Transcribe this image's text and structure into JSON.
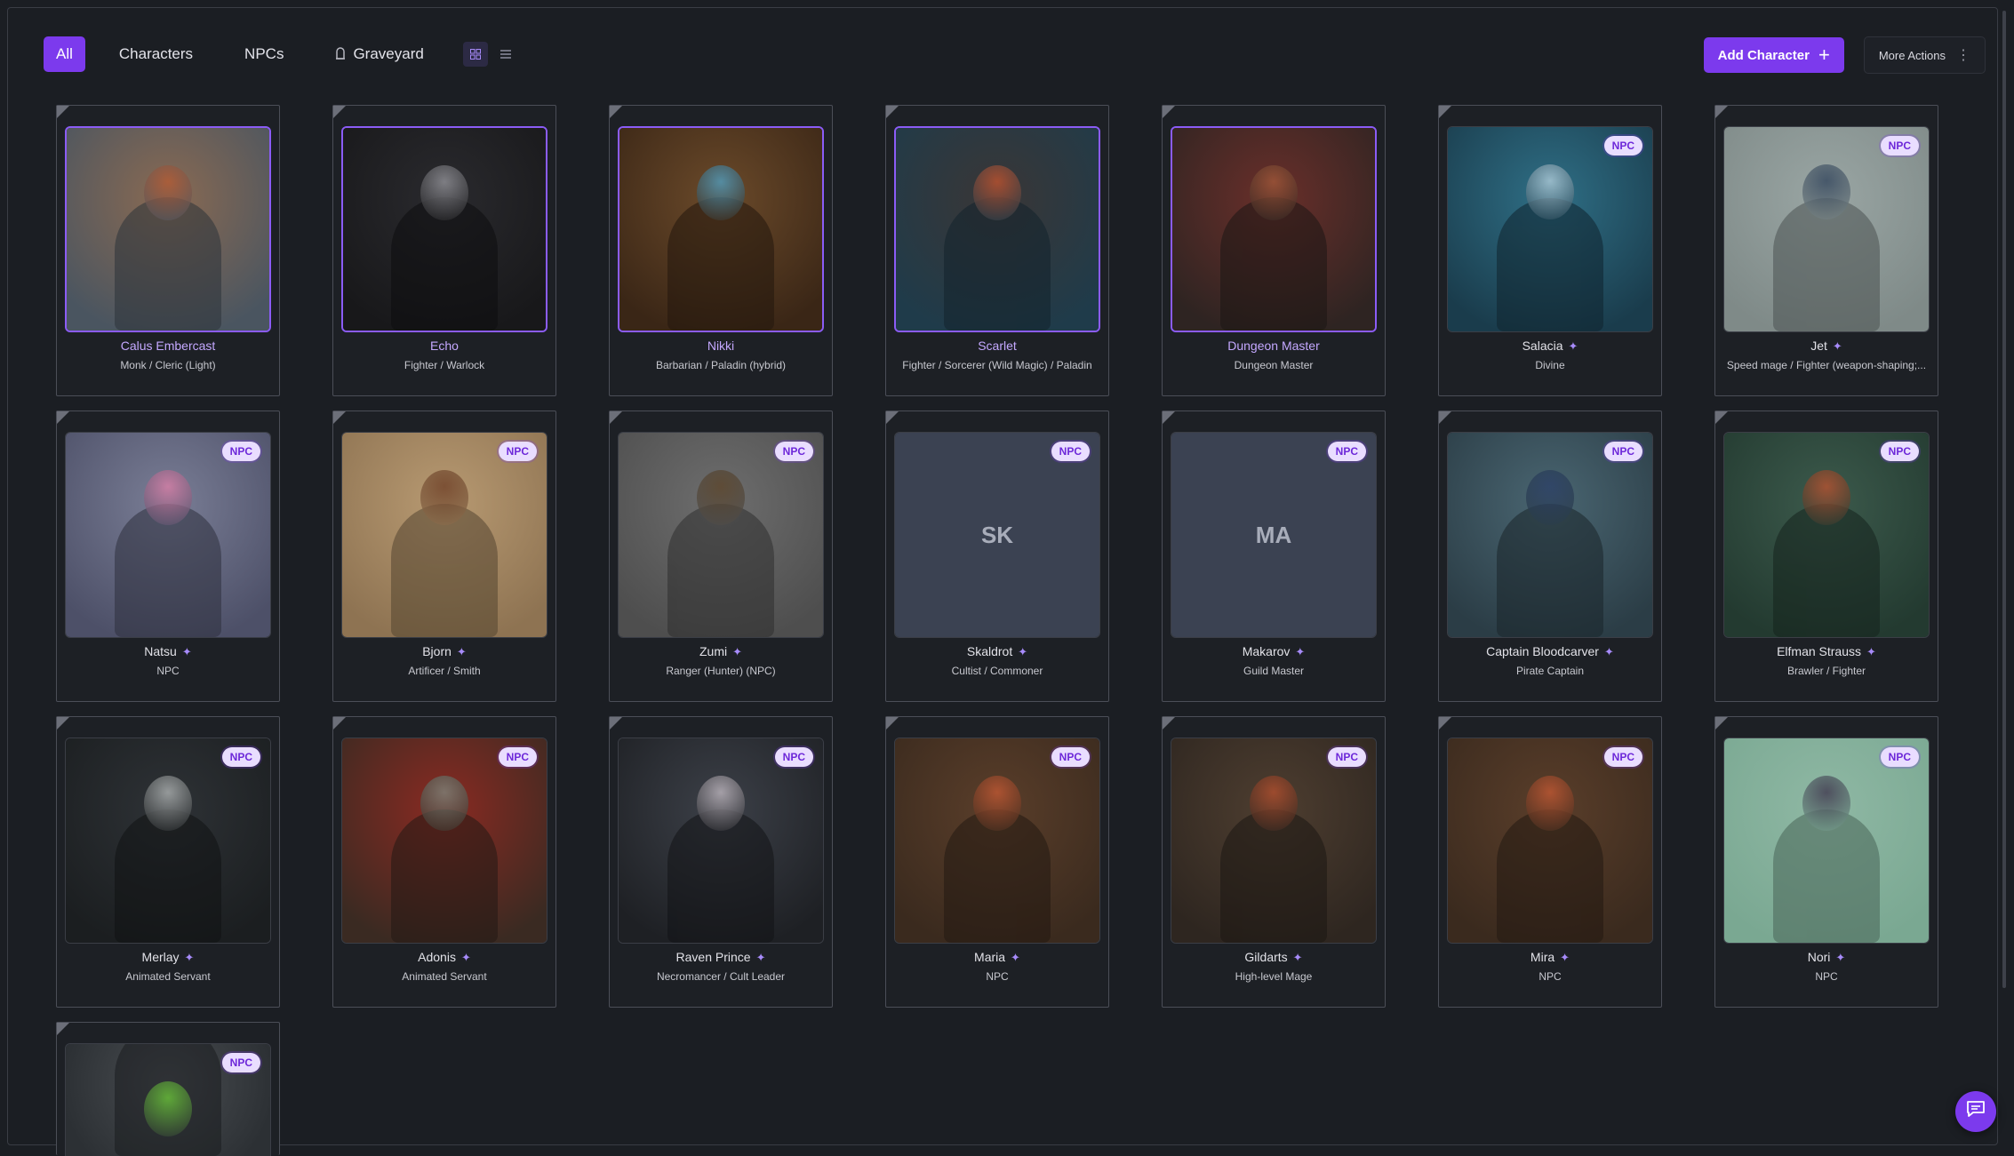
{
  "filters": {
    "tabs": [
      {
        "label": "All",
        "icon": ""
      },
      {
        "label": "Characters",
        "icon": ""
      },
      {
        "label": "NPCs",
        "icon": ""
      },
      {
        "label": "Graveyard",
        "icon": "tombstone-icon"
      }
    ],
    "view_modes": [
      "grid-view-icon",
      "list-view-icon"
    ]
  },
  "actions": {
    "add_label": "Add Character",
    "add_icon": "plus-icon",
    "more_label": "More Actions",
    "more_icon": "kebab-menu-icon"
  },
  "npc_badge": "NPC",
  "colors": {
    "accent": "#7c3aed",
    "background": "#1b1e23",
    "card_border": "#4b4e57",
    "badge_bg": "#e9ddff",
    "badge_text": "#6d28d9"
  },
  "characters": [
    {
      "name": "Calus Embercast",
      "subtitle": "Monk / Cleric (Light)",
      "npc": false,
      "linked": false,
      "c1": "#8a6a52",
      "c2": "#4a5560",
      "c3": "#b65a32"
    },
    {
      "name": "Echo",
      "subtitle": "Fighter / Warlock",
      "npc": false,
      "linked": false,
      "c1": "#2a2a2e",
      "c2": "#18181a",
      "c3": "#9a9aa0"
    },
    {
      "name": "Nikki",
      "subtitle": "Barbarian / Paladin (hybrid)",
      "npc": false,
      "linked": false,
      "c1": "#6b4a2a",
      "c2": "#3a2616",
      "c3": "#4fa3c9"
    },
    {
      "name": "Scarlet",
      "subtitle": "Fighter / Sorcerer (Wild Magic) / Paladin",
      "npc": false,
      "linked": false,
      "c1": "#3a3636",
      "c2": "#1f3b4a",
      "c3": "#c8552e"
    },
    {
      "name": "Dungeon Master",
      "subtitle": "Dungeon Master",
      "npc": false,
      "linked": false,
      "c1": "#6a2f2a",
      "c2": "#2e2422",
      "c3": "#a45a3a"
    },
    {
      "name": "Salacia",
      "subtitle": "Divine",
      "npc": true,
      "linked": true,
      "c1": "#2f6f86",
      "c2": "#1a3c4c",
      "c3": "#b9d3e0"
    },
    {
      "name": "Jet",
      "subtitle": "Speed mage / Fighter (weapon-shaping;...",
      "npc": true,
      "linked": true,
      "c1": "#9aa6a4",
      "c2": "#7f8a88",
      "c3": "#2c3f58"
    },
    {
      "name": "Natsu",
      "subtitle": "NPC",
      "npc": true,
      "linked": true,
      "c1": "#7a7e96",
      "c2": "#4d5068",
      "c3": "#e07fa8"
    },
    {
      "name": "Bjorn",
      "subtitle": "Artificer / Smith",
      "npc": true,
      "linked": true,
      "c1": "#b89a72",
      "c2": "#8e7352",
      "c3": "#6a3a22"
    },
    {
      "name": "Zumi",
      "subtitle": "Ranger (Hunter) (NPC)",
      "npc": true,
      "linked": true,
      "c1": "#6e6e6e",
      "c2": "#4e4e4e",
      "c3": "#5a4226"
    },
    {
      "name": "Skaldrot",
      "subtitle": "Cultist / Commoner",
      "npc": true,
      "linked": true,
      "initials": "SK"
    },
    {
      "name": "Makarov",
      "subtitle": "Guild Master",
      "npc": true,
      "linked": true,
      "initials": "MA"
    },
    {
      "name": "Captain Bloodcarver",
      "subtitle": "Pirate Captain",
      "npc": true,
      "linked": true,
      "c1": "#4a6672",
      "c2": "#2b3d46",
      "c3": "#2a3e66"
    },
    {
      "name": "Elfman Strauss",
      "subtitle": "Brawler / Fighter",
      "npc": true,
      "linked": true,
      "c1": "#3c5a4c",
      "c2": "#233a30",
      "c3": "#c0512e"
    },
    {
      "name": "Merlay",
      "subtitle": "Animated Servant",
      "npc": true,
      "linked": true,
      "c1": "#2e3236",
      "c2": "#1b1e20",
      "c3": "#b8bcbc"
    },
    {
      "name": "Adonis",
      "subtitle": "Animated Servant",
      "npc": true,
      "linked": true,
      "c1": "#8a2a22",
      "c2": "#3a2a22",
      "c3": "#7c8a80"
    },
    {
      "name": "Raven Prince",
      "subtitle": "Necromancer / Cult Leader",
      "npc": true,
      "linked": true,
      "c1": "#3c4048",
      "c2": "#1e2024",
      "c3": "#c8c0c8"
    },
    {
      "name": "Maria",
      "subtitle": "NPC",
      "npc": true,
      "linked": true,
      "c1": "#5a3e2a",
      "c2": "#3a2a1e",
      "c3": "#c85a34"
    },
    {
      "name": "Gildarts",
      "subtitle": "High-level Mage",
      "npc": true,
      "linked": true,
      "c1": "#4e3e30",
      "c2": "#2e2620",
      "c3": "#b8502e"
    },
    {
      "name": "Mira",
      "subtitle": "NPC",
      "npc": true,
      "linked": true,
      "c1": "#5a3e2a",
      "c2": "#3a2a1e",
      "c3": "#c85a34"
    },
    {
      "name": "Nori",
      "subtitle": "NPC",
      "npc": true,
      "linked": true,
      "c1": "#8fb8a4",
      "c2": "#7aa892",
      "c3": "#3a2e48"
    },
    {
      "name": "",
      "subtitle": "",
      "npc": true,
      "linked": false,
      "partial": true,
      "c1": "#4a4e52",
      "c2": "#2c3034",
      "c3": "#6fcf3a"
    }
  ],
  "chat_icon": "chat-bubble-icon"
}
